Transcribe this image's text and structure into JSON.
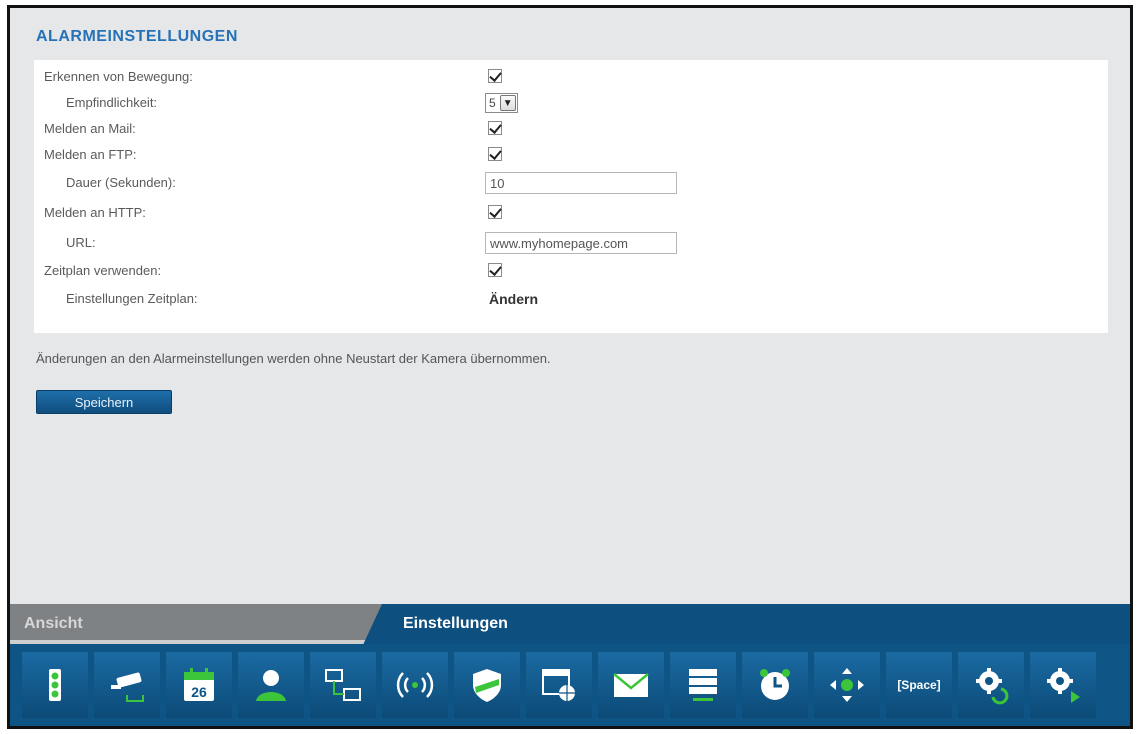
{
  "page": {
    "title": "ALARMEINSTELLUNGEN",
    "note": "Änderungen an den Alarmeinstellungen werden ohne Neustart der Kamera übernommen.",
    "save_label": "Speichern"
  },
  "settings": {
    "motion_label": "Erkennen von Bewegung:",
    "motion_checked": true,
    "sensitivity_label": "Empfindlichkeit:",
    "sensitivity_value": "5",
    "mail_label": "Melden an Mail:",
    "mail_checked": true,
    "ftp_label": "Melden an FTP:",
    "ftp_checked": true,
    "duration_label": "Dauer (Sekunden):",
    "duration_value": "10",
    "http_label": "Melden an HTTP:",
    "http_checked": true,
    "url_label": "URL:",
    "url_value": "www.myhomepage.com",
    "schedule_label": "Zeitplan verwenden:",
    "schedule_checked": true,
    "schedule_settings_label": "Einstellungen Zeitplan:",
    "schedule_change_label": "Ändern"
  },
  "tabs": {
    "view_label": "Ansicht",
    "settings_label": "Einstellungen"
  },
  "iconbar": {
    "calendar_day": "26",
    "space_label": "[Space]",
    "icons": [
      "status-icon",
      "camera-icon",
      "calendar-icon",
      "user-icon",
      "network-icon",
      "wireless-icon",
      "security-icon",
      "browser-icon",
      "mail-icon",
      "server-icon",
      "alarm-clock-icon",
      "ptz-icon",
      "space-icon",
      "settings-update-icon",
      "settings-play-icon"
    ]
  },
  "colors": {
    "title": "#2672b8",
    "tabbar": "#0d4f7f",
    "iconbar": "#0e5585",
    "accent_green": "#3cc43a"
  }
}
